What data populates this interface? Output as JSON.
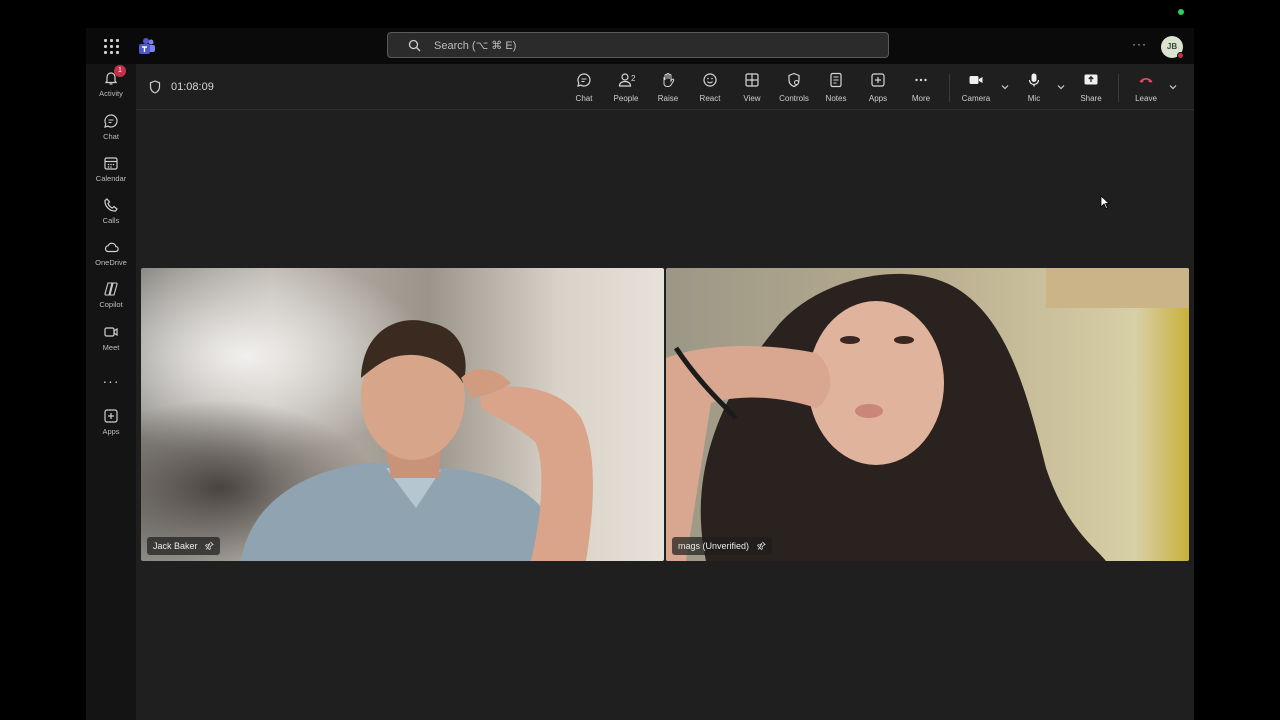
{
  "search": {
    "placeholder": "Search (⌥ ⌘ E)"
  },
  "user": {
    "initials": "JB"
  },
  "rail": {
    "items": [
      {
        "label": "Activity",
        "icon": "bell-icon",
        "badge": "1"
      },
      {
        "label": "Chat",
        "icon": "chat-icon"
      },
      {
        "label": "Calendar",
        "icon": "calendar-icon"
      },
      {
        "label": "Calls",
        "icon": "phone-icon"
      },
      {
        "label": "OneDrive",
        "icon": "cloud-icon"
      },
      {
        "label": "Copilot",
        "icon": "copilot-icon"
      },
      {
        "label": "Meet",
        "icon": "video-icon"
      },
      {
        "label": "Apps",
        "icon": "add-app-icon"
      }
    ]
  },
  "meeting": {
    "timer": "01:08:09",
    "controls": {
      "chat": "Chat",
      "people": "People",
      "people_count": "2",
      "raise": "Raise",
      "react": "React",
      "view": "View",
      "controls": "Controls",
      "notes": "Notes",
      "apps": "Apps",
      "more": "More",
      "camera": "Camera",
      "mic": "Mic",
      "share": "Share",
      "leave": "Leave"
    },
    "participants": [
      {
        "name": "Jack Baker"
      },
      {
        "name": "mags (Unverified)"
      }
    ]
  },
  "colors": {
    "leave": "#c4314b",
    "accent": "#7f85f5",
    "status": "#2fd05a"
  }
}
